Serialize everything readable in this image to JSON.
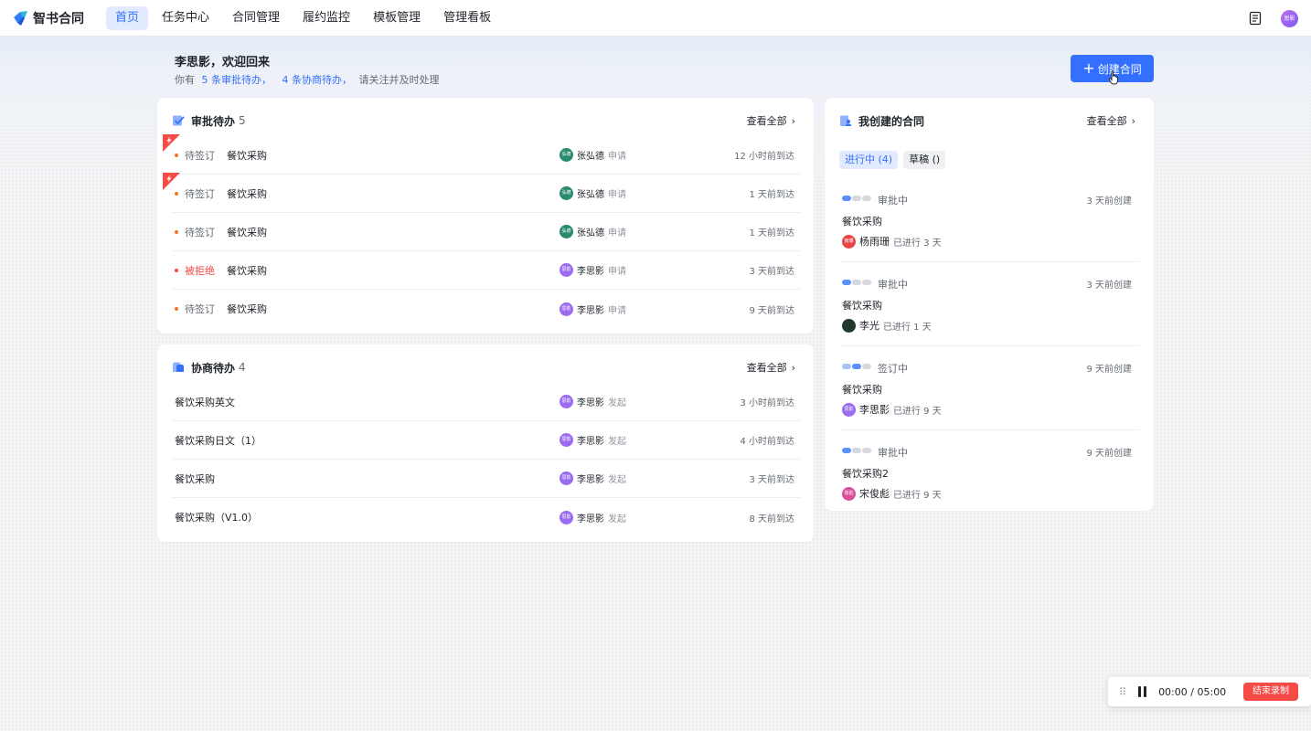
{
  "nav": {
    "logo_text": "智书合同",
    "items": [
      "首页",
      "任务中心",
      "合同管理",
      "履约监控",
      "模板管理",
      "管理看板"
    ],
    "active_index": 0,
    "avatar_text": "思影",
    "doc_icon": "document-icon"
  },
  "header": {
    "welcome": "李思影，欢迎回来",
    "sub_prefix": "你有",
    "approvals_link": "5 条审批待办，",
    "negotiations_link": "4 条协商待办，",
    "sub_suffix": "请关注并及时处理",
    "create_button": "创建合同",
    "create_icon": "+"
  },
  "approvals": {
    "title": "审批待办",
    "count": "5",
    "view_all": "查看全部",
    "rows": [
      {
        "status": "待签订",
        "name": "餐饮采购",
        "avatar": "弘德",
        "person": "张弘德",
        "action": "申请",
        "time": "12 小时前到达",
        "urgent": true,
        "rejected": false
      },
      {
        "status": "待签订",
        "name": "餐饮采购",
        "avatar": "弘德",
        "person": "张弘德",
        "action": "申请",
        "time": "1 天前到达",
        "urgent": true,
        "rejected": false
      },
      {
        "status": "待签订",
        "name": "餐饮采购",
        "avatar": "弘德",
        "person": "张弘德",
        "action": "申请",
        "time": "1 天前到达",
        "urgent": false,
        "rejected": false
      },
      {
        "status": "被拒绝",
        "name": "餐饮采购",
        "avatar": "思影",
        "person": "李思影",
        "action": "申请",
        "time": "3 天前到达",
        "urgent": false,
        "rejected": true
      },
      {
        "status": "待签订",
        "name": "餐饮采购",
        "avatar": "思影",
        "person": "李思影",
        "action": "申请",
        "time": "9 天前到达",
        "urgent": false,
        "rejected": false
      }
    ]
  },
  "negotiations": {
    "title": "协商待办",
    "count": "4",
    "view_all": "查看全部",
    "rows": [
      {
        "name": "餐饮采购英文",
        "avatar": "思影",
        "person": "李思影",
        "action": "发起",
        "time": "3 小时前到达"
      },
      {
        "name": "餐饮采购日文（1）",
        "avatar": "思影",
        "person": "李思影",
        "action": "发起",
        "time": "4 小时前到达"
      },
      {
        "name": "餐饮采购",
        "avatar": "思影",
        "person": "李思影",
        "action": "发起",
        "time": "3 天前到达"
      },
      {
        "name": "餐饮采购（V1.0）",
        "avatar": "思影",
        "person": "李思影",
        "action": "发起",
        "time": "8 天前到达"
      }
    ]
  },
  "my_contracts": {
    "title": "我创建的合同",
    "view_all": "查看全部",
    "tabs": [
      "进行中 (4)",
      "草稿 ()"
    ],
    "items": [
      {
        "status": "审批中",
        "time": "3 天前创建",
        "name": "餐饮采购",
        "avatar": "雨珊",
        "owner": "杨雨珊",
        "meta": "已进行 3 天",
        "stage": "approval"
      },
      {
        "status": "审批中",
        "time": "3 天前创建",
        "name": "餐饮采购",
        "avatar": "",
        "owner": "李光",
        "meta": "已进行 1 天",
        "stage": "approval"
      },
      {
        "status": "签订中",
        "time": "9 天前创建",
        "name": "餐饮采购",
        "avatar": "思影",
        "owner": "李思影",
        "meta": "已进行 9 天",
        "stage": "signing"
      },
      {
        "status": "审批中",
        "time": "9 天前创建",
        "name": "餐饮采购2",
        "avatar": "俊彪",
        "owner": "宋俊彪",
        "meta": "已进行 9 天",
        "stage": "approval"
      }
    ]
  },
  "recorder": {
    "elapsed": "00:00",
    "separator": "/",
    "total": "05:00",
    "stop_button": "结束录制"
  },
  "colors": {
    "accent": "#3370ff",
    "accent_bg": "#e1eaff",
    "danger": "#f54a45",
    "pending_dot": "#f27526"
  }
}
